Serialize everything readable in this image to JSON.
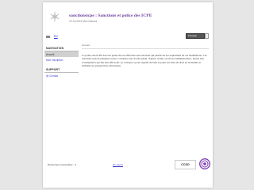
{
  "header": {
    "title": "sanctionsicpe : Sanctions et police des ICPE",
    "subtitle": "19 Jul 2021 Mon Discord"
  },
  "topbar": {
    "language_link": "EN",
    "language_select": "Français"
  },
  "sidebar": {
    "navigation_heading": "NAVIGATION",
    "navigation_items": [
      {
        "label": "Accueil",
        "active": true
      },
      {
        "label": "Mon inscription",
        "active": false
      }
    ],
    "support_heading": "SUPPORT",
    "support_items": [
      {
        "label": "@ Contact"
      }
    ]
  },
  "main": {
    "breadcrumb": "Accueil",
    "article": "La police des ICPE doit son partie de son efficacité aux sanctions qui pèsent sur les exploitants de ces installations. Ces sanctions sont de plusieurs sortes. Certaines sont d'ordre pénal, d'autres civiles ou encore administratives. Il peut leur accumulation qui fait leur efficacité. Le colloque a pour objectif de faire le point sur l'état du droit en la matière et d'étudier ses perspectives d'évolution."
  },
  "footer": {
    "users_online": "Personnes connectées : 3",
    "link": "En savoir",
    "partner_logo_text": "CCSO"
  },
  "colors": {
    "accent": "#6b3fa0",
    "link": "#3a3ad0",
    "background": "#e6e6e6"
  },
  "icons": [
    "snowflake-logo-icon",
    "home-icon",
    "badge-logo-icon"
  ]
}
